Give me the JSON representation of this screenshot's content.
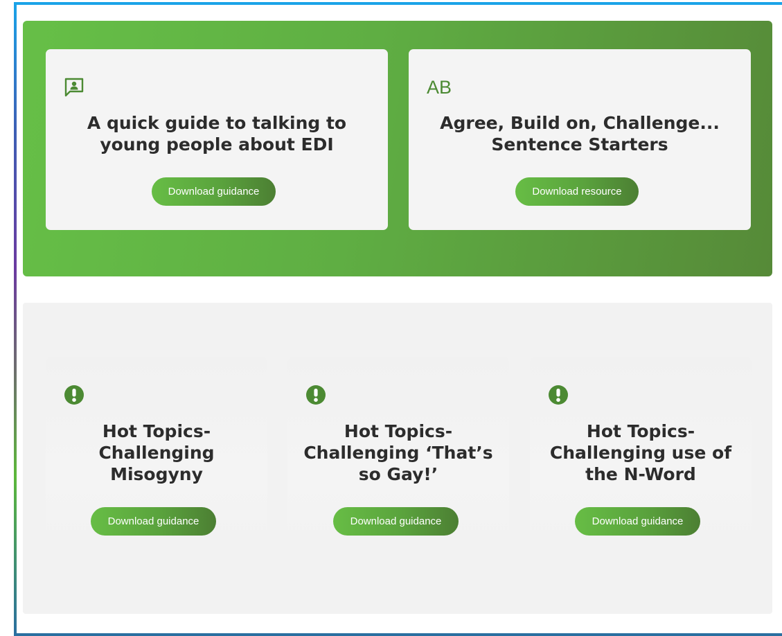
{
  "colors": {
    "accent": "#4c8a33",
    "band_green": "#5fae43",
    "card_bg": "#f4f4f4",
    "grey_band": "#f2f2f2",
    "title_text": "#2c2c2c"
  },
  "featured": [
    {
      "icon": "presentation-person-icon",
      "title": "A quick guide to talking to young people about EDI",
      "button_label": "Download guidance"
    },
    {
      "icon": "ab-letters-icon",
      "icon_text": "AB",
      "title": "Agree, Build on, Challenge... Sentence Starters",
      "button_label": "Download resource"
    }
  ],
  "hot_topics": [
    {
      "icon": "exclamation-circle-icon",
      "title": "Hot Topics- Challenging Misogyny",
      "button_label": "Download guidance"
    },
    {
      "icon": "exclamation-circle-icon",
      "title": "Hot Topics- Challenging ‘That’s so Gay!’",
      "button_label": "Download guidance"
    },
    {
      "icon": "exclamation-circle-icon",
      "title": "Hot Topics- Challenging use of the N-Word",
      "button_label": "Download guidance"
    }
  ]
}
